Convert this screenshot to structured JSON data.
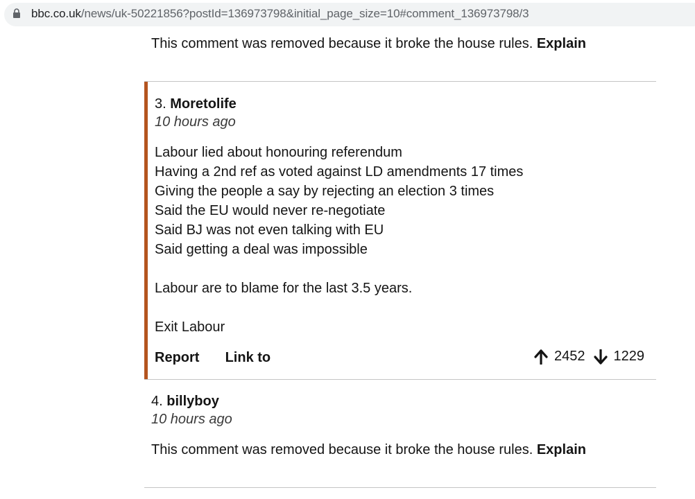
{
  "browser": {
    "url_domain": "bbc.co.uk",
    "url_path": "/news/uk-50221856?postId=136973798&initial_page_size=10#comment_136973798/3"
  },
  "comments": [
    {
      "removed_text": "This comment was removed because it broke the house rules.",
      "explain_label": "Explain"
    },
    {
      "number": "3.",
      "author": "Moretolife",
      "time": "10 hours ago",
      "body_lines": [
        "Labour lied about honouring referendum",
        "Having a 2nd ref as voted against LD amendments 17 times",
        "Giving the people a say by rejecting an election 3 times",
        "Said the EU would never re-negotiate",
        "Said BJ was not even talking with EU",
        "Said getting a deal was impossible",
        "",
        "Labour are to blame for the last 3.5 years.",
        "",
        "Exit Labour"
      ],
      "report_label": "Report",
      "link_label": "Link to",
      "upvotes": "2452",
      "downvotes": "1229"
    },
    {
      "number": "4.",
      "author": "billyboy",
      "time": "10 hours ago",
      "removed_text": "This comment was removed because it broke the house rules.",
      "explain_label": "Explain"
    }
  ],
  "colors": {
    "accent_border": "#b4541f",
    "divider": "#c4c4c4",
    "url_bar": "#f1f3f4"
  }
}
